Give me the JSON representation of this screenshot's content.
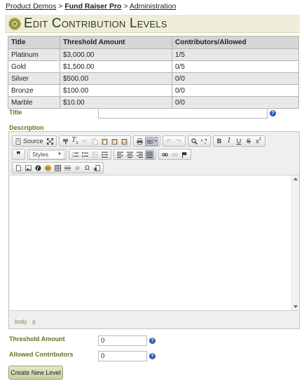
{
  "breadcrumb": {
    "items": [
      "Product Demos",
      "Fund Raiser Pro",
      "Administration"
    ],
    "separator": ">"
  },
  "page": {
    "title": "Edit Contribution Levels",
    "title_icon": "gear-badge-icon"
  },
  "levels_table": {
    "columns": [
      "Title",
      "Threshold Amount",
      "Contributors/Allowed"
    ],
    "rows": [
      [
        "Platinum",
        "$3,000.00",
        "1/5"
      ],
      [
        "Gold",
        "$1,500.00",
        "0/5"
      ],
      [
        "Silver",
        "$500.00",
        "0/0"
      ],
      [
        "Bronze",
        "$100.00",
        "0/0"
      ],
      [
        "Marble",
        "$10.00",
        "0/0"
      ]
    ]
  },
  "form": {
    "title_label": "Title",
    "title_value": "",
    "description_label": "Description",
    "threshold_label": "Threshold Amount",
    "threshold_value": "0",
    "allowed_label": "Allowed Contributors",
    "allowed_value": "0",
    "help_glyph": "?",
    "submit_label": "Create New Level"
  },
  "editor": {
    "source_label": "Source",
    "styles_label": "Styles",
    "element_path": [
      "body",
      "p"
    ]
  },
  "colors": {
    "label": "#6f6f20",
    "title_bar": "#eeeed8",
    "table_header": "#d6d6d6",
    "row_alt": "#e8e8e8",
    "help": "#2a5db0"
  }
}
